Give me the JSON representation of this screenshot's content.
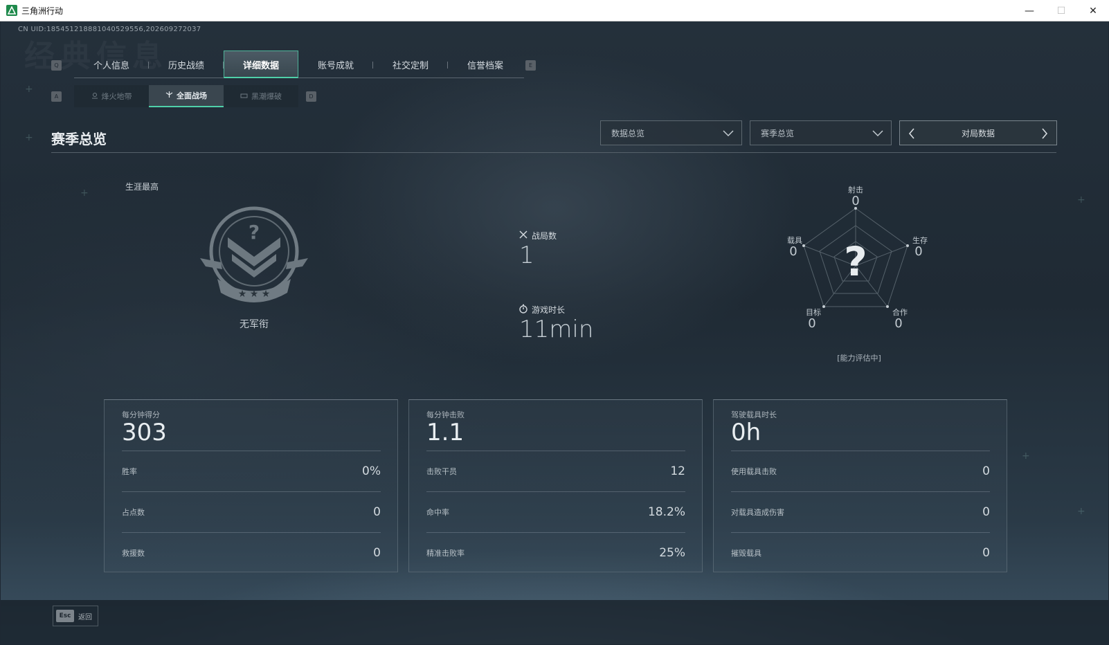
{
  "window": {
    "title": "三角洲行动",
    "minimize": "—",
    "maximize": "☐",
    "close": "✕"
  },
  "uid": "CN UID:1854512188810405295​56,202609272037",
  "watermark": "经典信息",
  "main_tabs": [
    {
      "label": "个人信息",
      "active": false
    },
    {
      "label": "历史战绩",
      "active": false
    },
    {
      "label": "详细数据",
      "active": true
    },
    {
      "label": "账号成就",
      "active": false
    },
    {
      "label": "社交定制",
      "active": false
    },
    {
      "label": "信誉档案",
      "active": false
    }
  ],
  "main_tabs_keys": {
    "prev": "Q",
    "next": "E"
  },
  "sub_tabs": [
    {
      "label": "烽火地带",
      "icon": "warzone-icon",
      "active": false
    },
    {
      "label": "全面战场",
      "active": true,
      "icon": "battlefield-icon"
    },
    {
      "label": "黑潮爆破",
      "active": false,
      "icon": "demolition-icon"
    }
  ],
  "sub_tabs_keys": {
    "prev": "A",
    "next": "D"
  },
  "section": {
    "title": "赛季总览",
    "dropdown_data": "数据总览",
    "dropdown_season": "赛季总览",
    "stepper_label": "对局数据"
  },
  "rank": {
    "career_label": "生涯最高",
    "name": "无军衔",
    "icon": "rank-badge-icon"
  },
  "summary": {
    "matches_label": "战局数",
    "matches_value": "1",
    "playtime_label": "游戏时长",
    "playtime_value": "11min"
  },
  "radar": {
    "axes": [
      {
        "label": "射击",
        "value": "0"
      },
      {
        "label": "生存",
        "value": "0"
      },
      {
        "label": "合作",
        "value": "0"
      },
      {
        "label": "目标",
        "value": "0"
      },
      {
        "label": "载具",
        "value": "0"
      }
    ],
    "center": "?",
    "status": "[能力评估中]"
  },
  "cards": [
    {
      "head_label": "每分钟得分",
      "head_value": "303",
      "rows": [
        {
          "k": "胜率",
          "v": "0%"
        },
        {
          "k": "占点数",
          "v": "0"
        },
        {
          "k": "救援数",
          "v": "0"
        }
      ]
    },
    {
      "head_label": "每分钟击败",
      "head_value": "1.1",
      "rows": [
        {
          "k": "击败干员",
          "v": "12"
        },
        {
          "k": "命中率",
          "v": "18.2%"
        },
        {
          "k": "精准击败率",
          "v": "25%"
        }
      ]
    },
    {
      "head_label": "驾驶载具时长",
      "head_value": "0h",
      "rows": [
        {
          "k": "使用载具击败",
          "v": "0"
        },
        {
          "k": "对载具造成伤害",
          "v": "0"
        },
        {
          "k": "摧毁载具",
          "v": "0"
        }
      ]
    }
  ],
  "footer": {
    "esc_key": "Esc",
    "back_label": "返回"
  },
  "colors": {
    "accent": "#4fd1a9",
    "background": "#1f2a34"
  }
}
